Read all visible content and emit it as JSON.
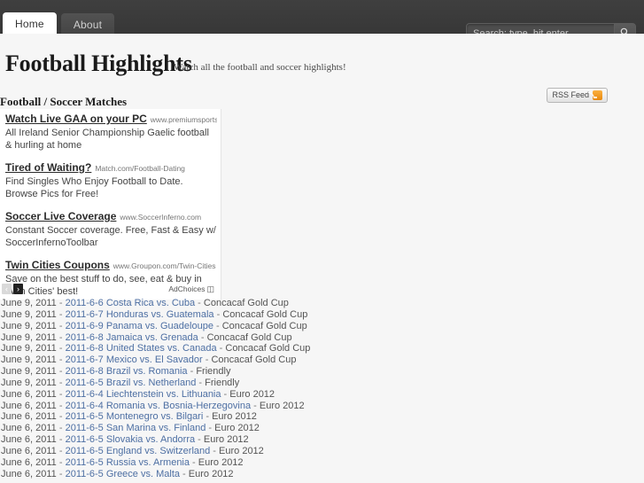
{
  "topbar": {
    "tabs": [
      {
        "label": "Home",
        "active": true
      },
      {
        "label": "About",
        "active": false
      }
    ],
    "search": {
      "placeholder": "Search: type, hit enter",
      "value": "",
      "button_icon": "search-icon"
    }
  },
  "header": {
    "title": "Football Highlights",
    "tagline": "Watch all the football and soccer highlights!"
  },
  "content": {
    "section_title": "Football / Soccer Matches",
    "rss": {
      "label": "RSS Feed",
      "icon": "rss-icon"
    }
  },
  "ads": {
    "items": [
      {
        "title": "Watch Live GAA on your PC",
        "url": "www.premiumsportsinc.c...",
        "description": "All Ireland Senior Championship Gaelic football & hurling at home"
      },
      {
        "title": "Tired of Waiting?",
        "url": "Match.com/Football-Dating",
        "description": "Find Singles Who Enjoy Football to Date. Browse Pics for Free!"
      },
      {
        "title": "Soccer Live Coverage",
        "url": "www.SoccerInferno.com",
        "description": "Constant Soccer coverage. Free, Fast & Easy w/ SoccerInfernoToolbar"
      },
      {
        "title": "Twin Cities Coupons",
        "url": "www.Groupon.com/Twin-Cities",
        "description": "Save on the best stuff to do, see, eat & buy in Twin Cities' best!"
      }
    ],
    "prev_label": "‹",
    "next_label": "›",
    "adchoices_label": "AdChoices",
    "adchoices_icon": "adchoices-triangle-icon"
  },
  "matches": [
    {
      "date": "June 9, 2011",
      "link": "2011-6-6 Costa Rica vs. Cuba",
      "competition": "Concacaf Gold Cup"
    },
    {
      "date": "June 9, 2011",
      "link": "2011-6-7 Honduras vs. Guatemala",
      "competition": "Concacaf Gold Cup"
    },
    {
      "date": "June 9, 2011",
      "link": "2011-6-9 Panama vs. Guadeloupe",
      "competition": "Concacaf Gold Cup"
    },
    {
      "date": "June 9, 2011",
      "link": "2011-6-8 Jamaica vs. Grenada",
      "competition": "Concacaf Gold Cup"
    },
    {
      "date": "June 9, 2011",
      "link": "2011-6-8 United States vs. Canada",
      "competition": "Concacaf Gold Cup"
    },
    {
      "date": "June 9, 2011",
      "link": "2011-6-7 Mexico vs. El Savador",
      "competition": "Concacaf Gold Cup"
    },
    {
      "date": "June 9, 2011",
      "link": "2011-6-8 Brazil vs. Romania",
      "competition": "Friendly"
    },
    {
      "date": "June 9, 2011",
      "link": "2011-6-5 Brazil vs. Netherland",
      "competition": "Friendly"
    },
    {
      "date": "June 6, 2011",
      "link": "2011-6-4 Liechtenstein vs. Lithuania",
      "competition": "Euro 2012"
    },
    {
      "date": "June 6, 2011",
      "link": "2011-6-4 Romania vs. Bosnia-Herzegovina",
      "competition": "Euro 2012"
    },
    {
      "date": "June 6, 2011",
      "link": "2011-6-5 Montenegro vs. Bilgari",
      "competition": "Euro 2012"
    },
    {
      "date": "June 6, 2011",
      "link": "2011-6-5 San Marina vs. Finland",
      "competition": "Euro 2012"
    },
    {
      "date": "June 6, 2011",
      "link": "2011-6-5 Slovakia vs. Andorra",
      "competition": "Euro 2012"
    },
    {
      "date": "June 6, 2011",
      "link": "2011-6-5 England vs. Switzerland",
      "competition": "Euro 2012"
    },
    {
      "date": "June 6, 2011",
      "link": "2011-6-5 Russia vs. Armenia",
      "competition": "Euro 2012"
    },
    {
      "date": "June 6, 2011",
      "link": "2011-6-5 Greece vs. Malta",
      "competition": "Euro 2012"
    }
  ],
  "colors": {
    "topbar": "#3b3b3b",
    "page_background": "#f6f6f6",
    "link": "#4d6fa3",
    "rss_orange": "#f19a2b"
  }
}
